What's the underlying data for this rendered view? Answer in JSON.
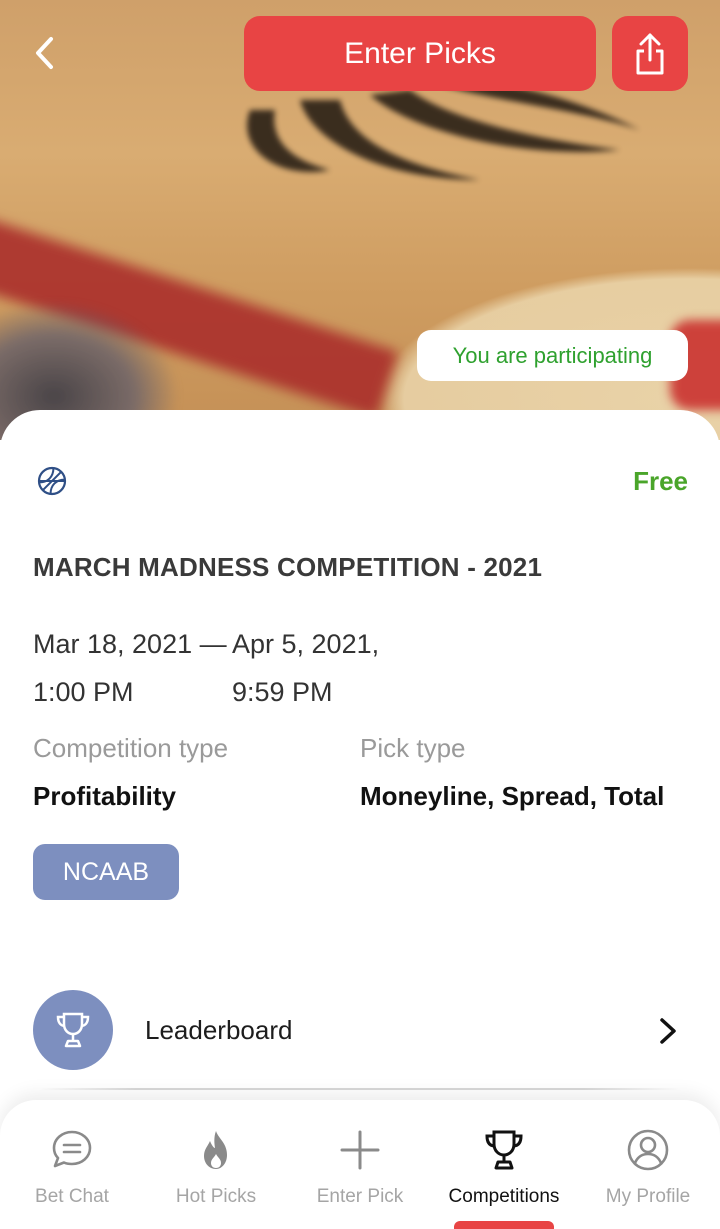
{
  "header": {
    "back_icon": "chevron-left-icon",
    "enter_picks_label": "Enter Picks",
    "share_icon": "share-icon",
    "participating_label": "You are participating"
  },
  "competition": {
    "sport_icon": "basketball-icon",
    "price": "Free",
    "title": "MARCH MADNESS COMPETITION - 2021",
    "start_date": "Mar 18, 2021",
    "start_time": "1:00 PM",
    "separator": "—",
    "end_date": "Apr 5, 2021,",
    "end_time": "9:59 PM",
    "competition_type_label": "Competition type",
    "competition_type_value": "Profitability",
    "pick_type_label": "Pick type",
    "pick_type_value": "Moneyline, Spread, Total",
    "league_tag": "NCAAB"
  },
  "leaderboard": {
    "label": "Leaderboard",
    "icon": "trophy-icon"
  },
  "bottom_nav": {
    "items": [
      {
        "label": "Bet Chat",
        "icon": "chat-bubble-icon"
      },
      {
        "label": "Hot Picks",
        "icon": "flame-icon"
      },
      {
        "label": "Enter Pick",
        "icon": "plus-icon"
      },
      {
        "label": "Competitions",
        "icon": "trophy-icon"
      },
      {
        "label": "My Profile",
        "icon": "user-circle-icon"
      }
    ],
    "active_index": 3
  },
  "colors": {
    "accent_red": "#e84444",
    "success_green": "#2fa12f",
    "price_green": "#4aa52a",
    "tag_blue": "#7d8fbf"
  }
}
